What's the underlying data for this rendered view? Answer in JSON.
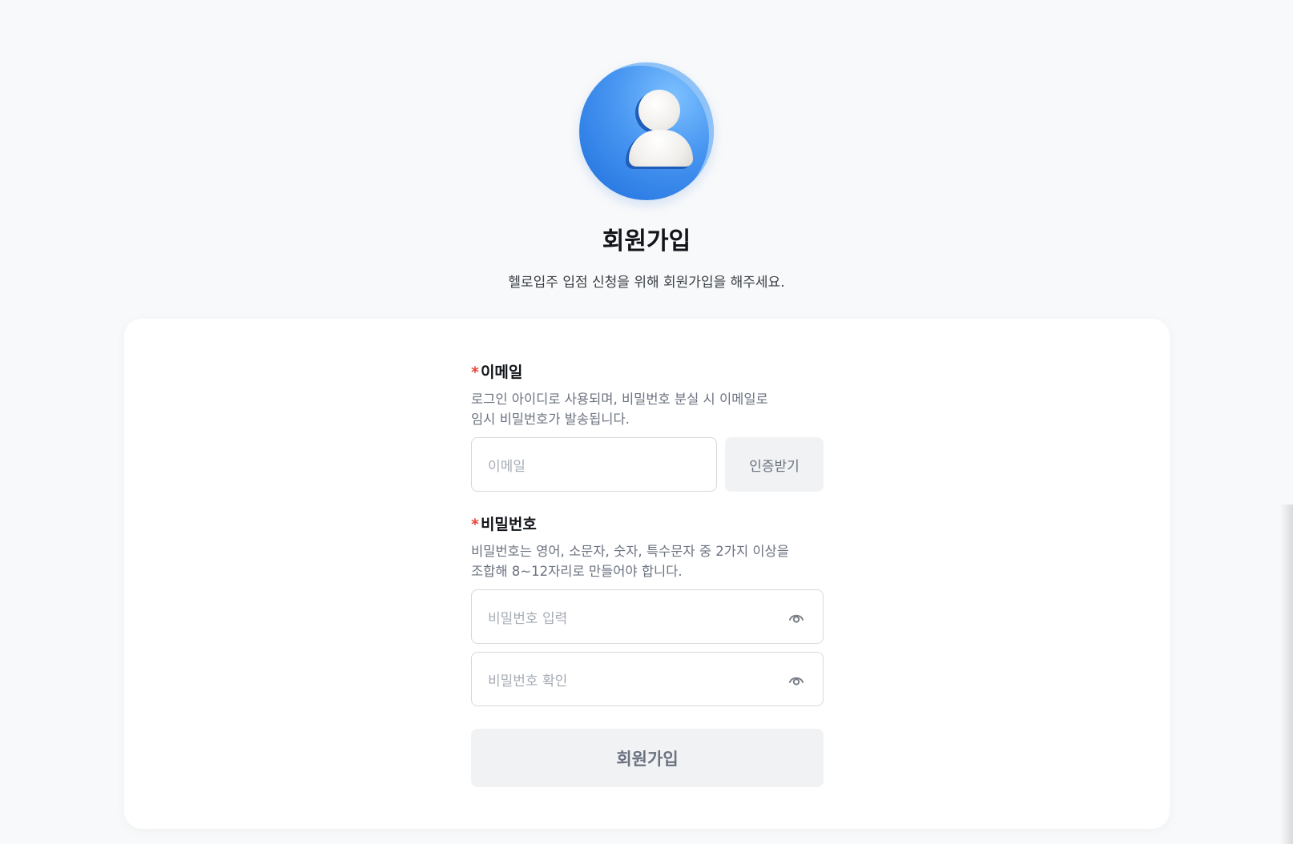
{
  "header": {
    "title": "회원가입",
    "subtitle": "헬로입주 입점 신청을 위해 회원가입을 해주세요."
  },
  "email": {
    "required_mark": "*",
    "label": "이메일",
    "description_line1": "로그인 아이디로 사용되며, 비밀번호 분실 시 이메일로",
    "description_line2": "임시 비밀번호가 발송됩니다.",
    "placeholder": "이메일",
    "verify_button": "인증받기"
  },
  "password": {
    "required_mark": "*",
    "label": "비밀번호",
    "description_line1": "비밀번호는 영어, 소문자, 숫자, 특수문자 중 2가지 이상을",
    "description_line2": "조합해 8~12자리로 만들어야 합니다.",
    "placeholder": "비밀번호 입력",
    "confirm_placeholder": "비밀번호 확인"
  },
  "submit_button": "회원가입",
  "colors": {
    "background": "#f8f9fa",
    "card": "#ffffff",
    "required": "#e5483b",
    "avatar": "#4a98f2"
  }
}
